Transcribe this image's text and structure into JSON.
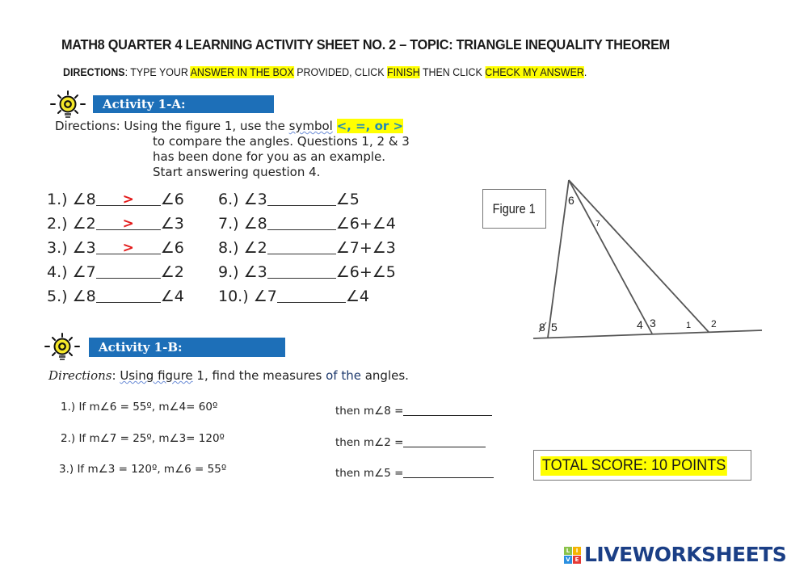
{
  "header": {
    "title": "MATH8 QUARTER 4 LEARNING ACTIVITY SHEET NO. 2 – TOPIC: TRIANGLE INEQUALITY THEOREM",
    "directions_label": "DIRECTIONS",
    "directions_parts": [
      ": TYPE YOUR ",
      "ANSWER IN THE BOX",
      " PROVIDED, CLICK ",
      "FINISH",
      " THEN CLICK ",
      "CHECK MY ANSWER",
      "."
    ]
  },
  "activity_a": {
    "banner": "Activity 1-A:",
    "icon": "lightbulb-gear-icon",
    "directions_label": "Directions:",
    "directions_line1_a": " Using the figure 1, use the ",
    "directions_symbol_word": "symbol",
    "directions_symbols": "<,  =, or >",
    "directions_line2": "to compare the angles. Questions 1, 2 & 3",
    "directions_line3": "has been done for you as an example.",
    "directions_line4": "Start answering question 4.",
    "questions": [
      {
        "num": "1.)",
        "left": "∠8",
        "answer": ">",
        "right": "∠6"
      },
      {
        "num": "2.)",
        "left": "∠2",
        "answer": ">",
        "right": "∠3"
      },
      {
        "num": "3.)",
        "left": "∠3",
        "answer": ">",
        "right": "∠6"
      },
      {
        "num": "4.)",
        "left": "∠7",
        "answer": "",
        "right": "∠2"
      },
      {
        "num": "5.)",
        "left": "∠8",
        "answer": "",
        "right": "∠4"
      },
      {
        "num": "6.)",
        "left": "∠3",
        "answer": "",
        "right": "∠5"
      },
      {
        "num": "7.)",
        "left": "∠8",
        "answer": "",
        "right": "∠6+∠4"
      },
      {
        "num": "8.)",
        "left": "∠2",
        "answer": "",
        "right": "∠7+∠3"
      },
      {
        "num": "9.)",
        "left": "∠3",
        "answer": "",
        "right": "∠6+∠5"
      },
      {
        "num": "10.)",
        "left": "∠7",
        "answer": "",
        "right": "∠4"
      }
    ]
  },
  "figure": {
    "label": "Figure 1",
    "angle_labels": [
      "6",
      "7",
      "8",
      "5",
      "4",
      "3",
      "1",
      "2"
    ]
  },
  "activity_b": {
    "banner": "Activity 1-B:",
    "icon": "lightbulb-gear-icon",
    "directions_label": "Directions",
    "directions_colon": ": ",
    "directions_underlined": "Using  figure",
    "directions_mid": " 1, find the measures ",
    "directions_navy": "of the",
    "directions_end": " angles.",
    "questions": [
      {
        "num": "1.)",
        "given": "If m∠6 = 55º,  m∠4= 60º",
        "find": "then m∠8 =",
        "answer": ""
      },
      {
        "num": "2.)",
        "given": "If m∠7 = 25º,  m∠3= 120º",
        "find": "then m∠2 =",
        "answer": ""
      },
      {
        "num": "3.)",
        "given": " If m∠3 = 120º, m∠6 = 55º",
        "find": "then m∠5 =",
        "answer": ""
      }
    ]
  },
  "score": {
    "text": "TOTAL SCORE: 10 POINTS"
  },
  "footer": {
    "logo_tiles": [
      "L",
      "I",
      "V",
      "E"
    ],
    "logo_text": "LIVEWORKSHEETS"
  },
  "colors": {
    "banner_blue": "#1d6fb8",
    "highlight": "#ffff00",
    "answer_red": "#e31b1b",
    "logo_navy": "#1b3f86"
  }
}
